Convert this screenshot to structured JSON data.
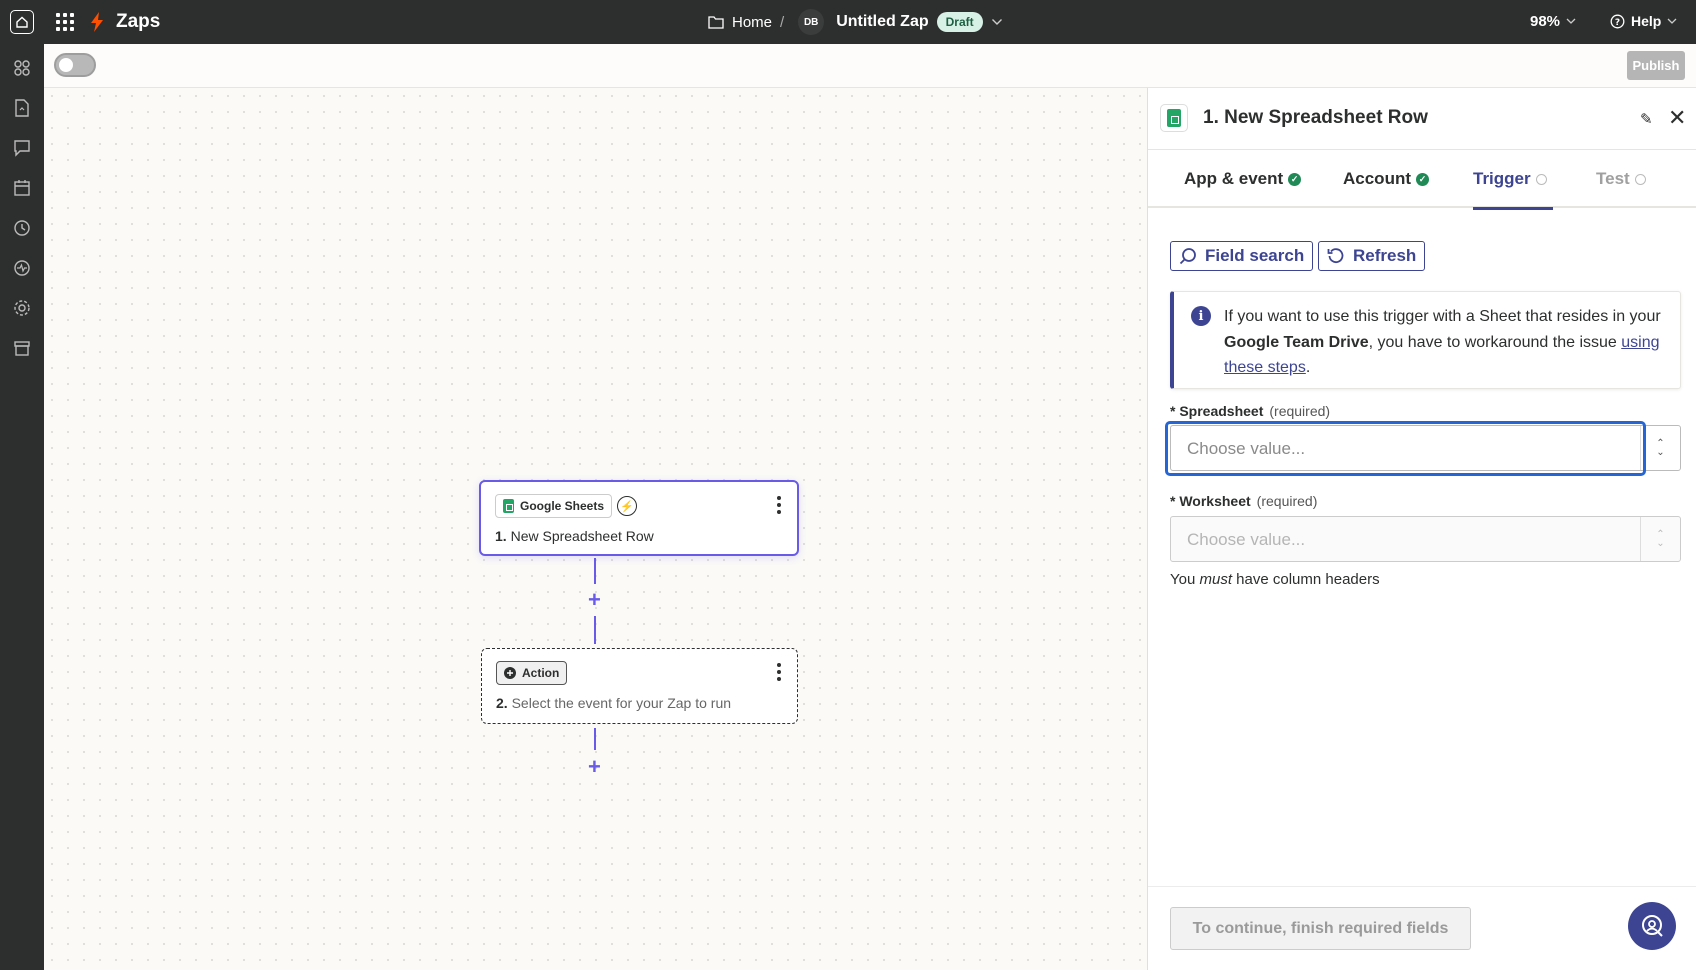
{
  "topbar": {
    "app_name": "Zaps",
    "breadcrumb_home": "Home",
    "breadcrumb_sep": "/",
    "owner_initials": "DB",
    "zap_title": "Untitled Zap",
    "status": "Draft",
    "zoom": "98%",
    "help": "Help"
  },
  "toolbar": {
    "publish": "Publish"
  },
  "canvas": {
    "step1": {
      "app": "Google Sheets",
      "number": "1.",
      "title": "New Spreadsheet Row"
    },
    "step2": {
      "badge": "Action",
      "number": "2.",
      "title": "Select the event for your Zap to run"
    }
  },
  "panel": {
    "title": "1. New Spreadsheet Row",
    "tabs": [
      {
        "label": "App & event",
        "state": "complete"
      },
      {
        "label": "Account",
        "state": "complete"
      },
      {
        "label": "Trigger",
        "state": "active"
      },
      {
        "label": "Test",
        "state": "disabled"
      }
    ],
    "field_search": "Field search",
    "refresh": "Refresh",
    "info": {
      "text1": "If you want to use this trigger with a Sheet that resides in your ",
      "bold": "Google Team Drive",
      "text2": ", you have to workaround the issue ",
      "link": "using these steps",
      "text3": "."
    },
    "spreadsheet": {
      "label": "* Spreadsheet",
      "required": "(required)",
      "placeholder": "Choose value..."
    },
    "worksheet": {
      "label": "* Worksheet",
      "required": "(required)",
      "placeholder": "Choose value..."
    },
    "hint_pre": "You ",
    "hint_em": "must",
    "hint_post": " have column headers",
    "continue": "To continue, finish required fields"
  },
  "colors": {
    "accent": "#3d4592",
    "brand": "#ff4f00",
    "sheets": "#23a566",
    "focus": "#2466d6"
  }
}
